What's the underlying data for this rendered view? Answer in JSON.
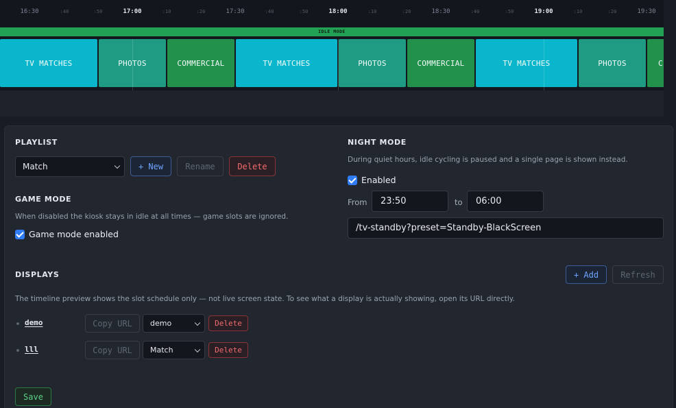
{
  "timeline": {
    "ruler": {
      "major_ticks": [
        {
          "label": "16:30",
          "hour": false
        },
        {
          "label": "17:00",
          "hour": true
        },
        {
          "label": "17:30",
          "hour": false
        },
        {
          "label": "18:00",
          "hour": true
        },
        {
          "label": "18:30",
          "hour": false
        },
        {
          "label": "19:00",
          "hour": true
        },
        {
          "label": "19:30",
          "hour": false
        }
      ],
      "minor_ticks": [
        ":40",
        ":50",
        ":10",
        ":20",
        ":40",
        ":50",
        ":10",
        ":20",
        ":40",
        ":50",
        ":10",
        ":20",
        ":40",
        ":50",
        ":10",
        ":20"
      ]
    },
    "idle_band_label": "IDLE MODE",
    "slots": [
      {
        "label": "TV MATCHES",
        "kind": "tv"
      },
      {
        "label": "PHOTOS",
        "kind": "photos"
      },
      {
        "label": "COMMERCIAL",
        "kind": "commercial"
      },
      {
        "label": "TV MATCHES",
        "kind": "tv"
      },
      {
        "label": "PHOTOS",
        "kind": "photos"
      },
      {
        "label": "COMMERCIAL",
        "kind": "commercial"
      },
      {
        "label": "TV MATCHES",
        "kind": "tv"
      },
      {
        "label": "PHOTOS",
        "kind": "photos"
      },
      {
        "label": "C",
        "kind": "commercial"
      }
    ],
    "colors": {
      "tv": "#09b6cb",
      "photos": "#1f9b84",
      "commercial": "#22914c",
      "idle": "#22a154"
    }
  },
  "playlist": {
    "title": "PLAYLIST",
    "selected": "Match",
    "new_label": "+ New",
    "rename_label": "Rename",
    "delete_label": "Delete"
  },
  "game_mode": {
    "title": "GAME MODE",
    "description": "When disabled the kiosk stays in idle at all times — game slots are ignored.",
    "checkbox_label": "Game mode enabled",
    "checked": true
  },
  "night_mode": {
    "title": "NIGHT MODE",
    "description": "During quiet hours, idle cycling is paused and a single page is shown instead.",
    "enabled_label": "Enabled",
    "enabled": true,
    "from_label": "From",
    "from_value": "23:50",
    "to_label": "to",
    "to_value": "06:00",
    "url_value": "/tv-standby?preset=Standby-BlackScreen"
  },
  "displays": {
    "title": "DISPLAYS",
    "add_label": "+ Add",
    "refresh_label": "Refresh",
    "description": "The timeline preview shows the slot schedule only — not live screen state. To see what a display is actually showing, open its URL directly.",
    "rows": [
      {
        "name": "demo",
        "copy_label": "Copy URL",
        "playlist": "demo",
        "delete_label": "Delete"
      },
      {
        "name": "lll",
        "copy_label": "Copy URL",
        "playlist": "Match",
        "delete_label": "Delete"
      }
    ]
  },
  "save_label": "Save",
  "accent_color": "#2f7cf6"
}
